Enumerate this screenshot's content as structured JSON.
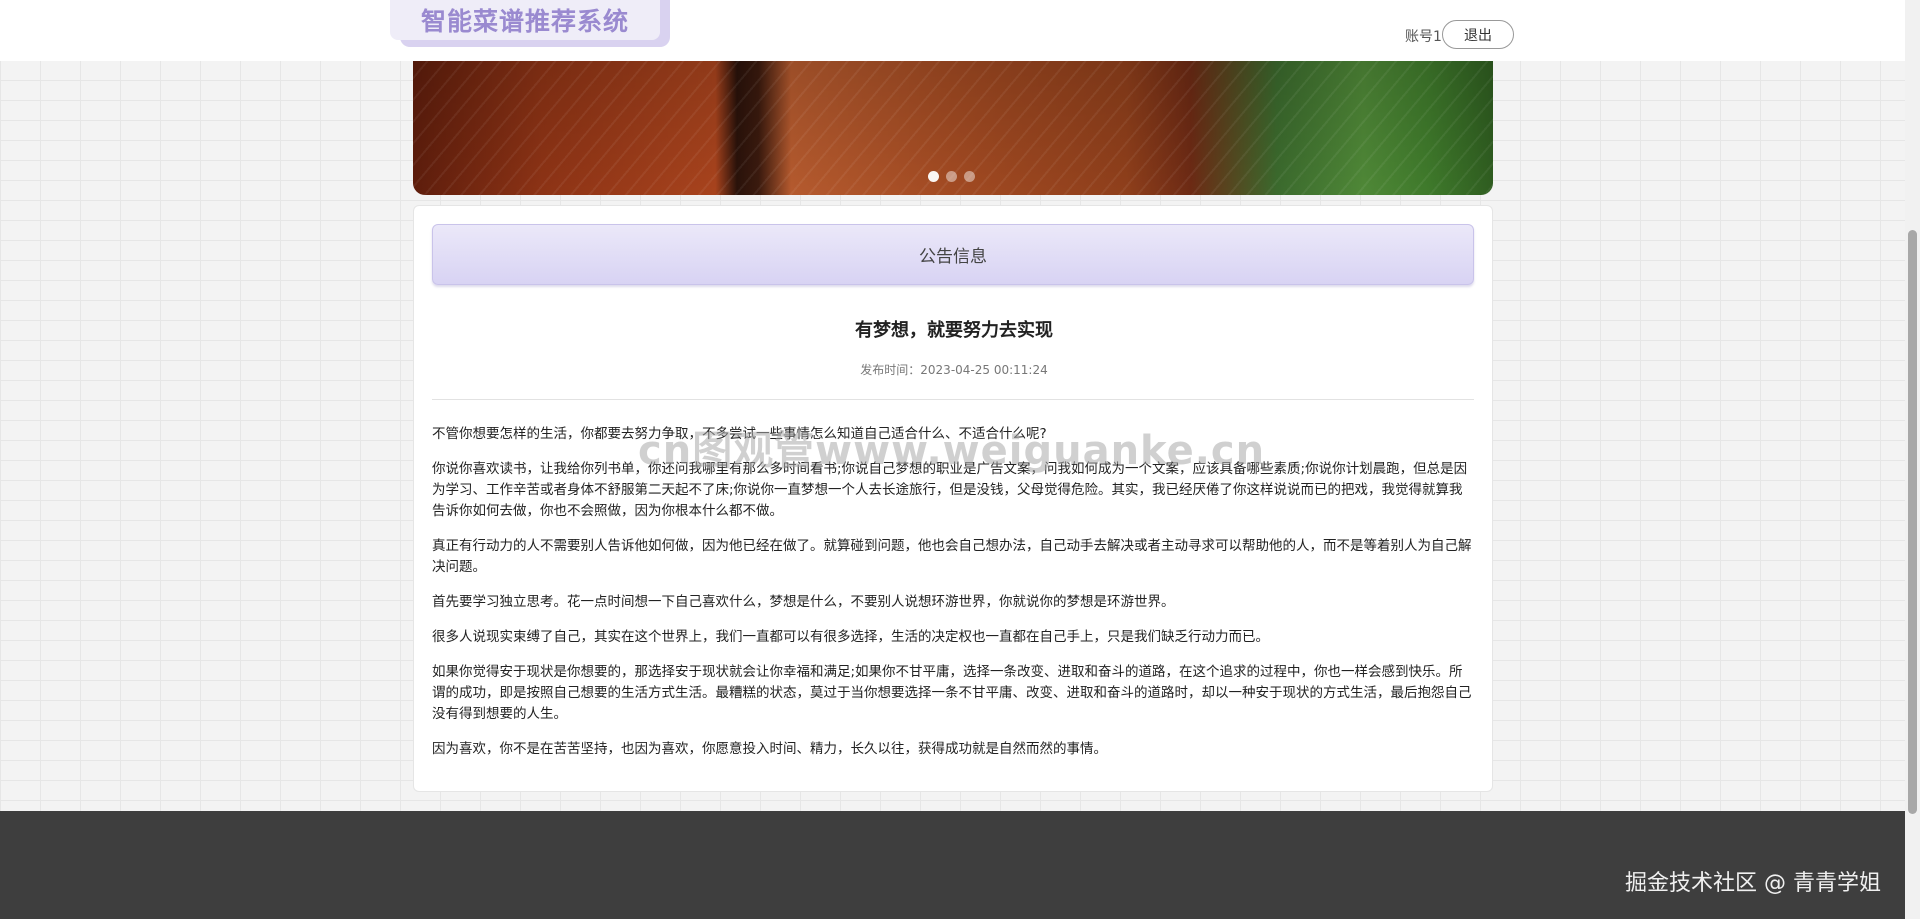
{
  "header": {
    "logo": "智能菜谱推荐系统",
    "account": "账号1",
    "logout_label": "退出"
  },
  "banner": {
    "slide_count": 3,
    "active_slide": 1
  },
  "notice": {
    "section_title": "公告信息",
    "title": "有梦想，就要努力去实现",
    "time_label": "发布时间：",
    "time": "2023-04-25 00:11:24",
    "paragraphs": [
      "不管你想要怎样的生活，你都要去努力争取，不多尝试一些事情怎么知道自己适合什么、不适合什么呢?",
      "你说你喜欢读书，让我给你列书单，你还问我哪里有那么多时间看书;你说自己梦想的职业是广告文案，问我如何成为一个文案，应该具备哪些素质;你说你计划晨跑，但总是因为学习、工作辛苦或者身体不舒服第二天起不了床;你说你一直梦想一个人去长途旅行，但是没钱，父母觉得危险。其实，我已经厌倦了你这样说说而已的把戏，我觉得就算我告诉你如何去做，你也不会照做，因为你根本什么都不做。",
      "真正有行动力的人不需要别人告诉他如何做，因为他已经在做了。就算碰到问题，他也会自己想办法，自己动手去解决或者主动寻求可以帮助他的人，而不是等着别人为自己解决问题。",
      "首先要学习独立思考。花一点时间想一下自己喜欢什么，梦想是什么，不要别人说想环游世界，你就说你的梦想是环游世界。",
      "很多人说现实束缚了自己，其实在这个世界上，我们一直都可以有很多选择，生活的决定权也一直都在自己手上，只是我们缺乏行动力而已。",
      "如果你觉得安于现状是你想要的，那选择安于现状就会让你幸福和满足;如果你不甘平庸，选择一条改变、进取和奋斗的道路，在这个追求的过程中，你也一样会感到快乐。所谓的成功，即是按照自己想要的生活方式生活。最糟糕的状态，莫过于当你想要选择一条不甘平庸、改变、进取和奋斗的道路时，却以一种安于现状的方式生活，最后抱怨自己没有得到想要的人生。",
      "因为喜欢，你不是在苦苦坚持，也因为喜欢，你愿意投入时间、精力，长久以往，获得成功就是自然而然的事情。"
    ]
  },
  "watermark": "cn图观管www.weiguanke.cn",
  "footer": {
    "credit": "掘金技术社区 @ 青青学姐"
  }
}
